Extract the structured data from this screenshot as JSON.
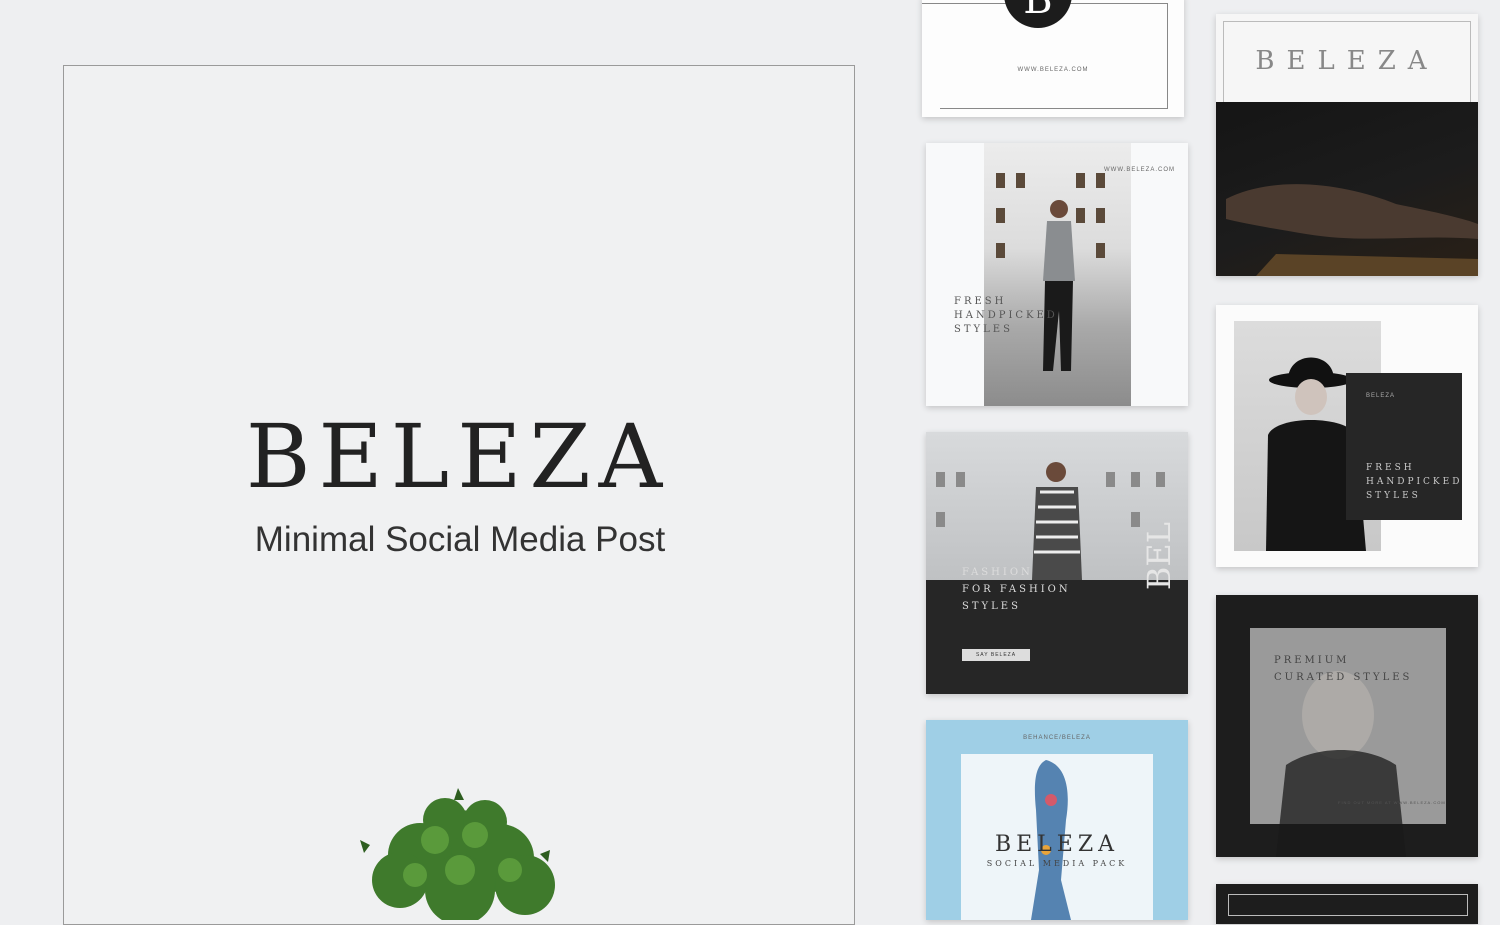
{
  "poster": {
    "brand": "BELEZA",
    "tagline": "Minimal Social Media Post"
  },
  "cards": {
    "c1": {
      "monogram": "B",
      "url": "WWW.BELEZA.COM"
    },
    "c2": {
      "brand": "BELEZA"
    },
    "c3": {
      "url": "WWW.BELEZA.COM",
      "line1": "FRESH",
      "line2": "HANDPICKED",
      "line3": "STYLES"
    },
    "c4": {
      "label": "BELEZA",
      "line1": "FRESH",
      "line2": "HANDPICKED",
      "line3": "STYLES"
    },
    "c5": {
      "line1": "FASHION",
      "line2": "FOR FASHION",
      "line3": "STYLES",
      "button": "SAY BELEZA",
      "vertical": "BEL"
    },
    "c6": {
      "line1": "PREMIUM",
      "line2": "CURATED STYLES",
      "footer": "FIND OUT MORE AT WWW.BELEZA.COM"
    },
    "c7": {
      "top": "BEHANCE/BELEZA",
      "brand": "BELEZA",
      "sub": "SOCIAL MEDIA PACK"
    }
  },
  "colors": {
    "background": "#eeeff1",
    "dark": "#222222",
    "sky": "#9fcfe6"
  },
  "icons": [
    "plant-icon"
  ]
}
